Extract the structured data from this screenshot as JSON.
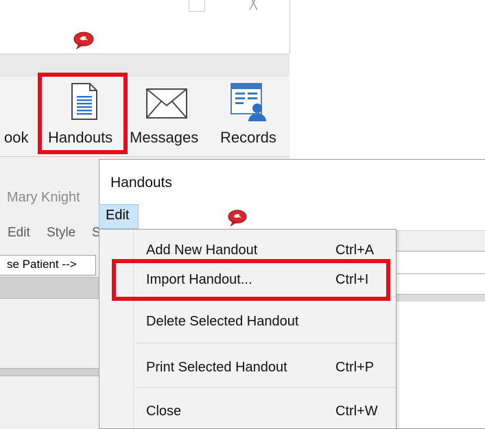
{
  "window_controls": {
    "minimize": "",
    "close": "╳"
  },
  "toolbar": {
    "items": [
      {
        "label": "ook",
        "icon": "address-book-icon"
      },
      {
        "label": "Handouts",
        "icon": "document-icon",
        "highlighted": true
      },
      {
        "label": "Messages",
        "icon": "envelope-icon"
      },
      {
        "label": "Records",
        "icon": "patient-record-icon"
      }
    ]
  },
  "background": {
    "patient_name": "Mary Knight",
    "menu_items": [
      "Edit",
      "Style",
      "S"
    ],
    "patient_select": "se Patient -->"
  },
  "handouts_window": {
    "title": "Handouts",
    "menu": {
      "edit_label": "Edit"
    }
  },
  "edit_menu": {
    "items": [
      {
        "label": "Add New Handout",
        "shortcut": "Ctrl+A"
      },
      {
        "label": "Import Handout...",
        "shortcut": "Ctrl+I",
        "highlighted": true
      },
      {
        "label": "Delete Selected Handout",
        "shortcut": ""
      },
      {
        "label": "Print Selected Handout",
        "shortcut": "Ctrl+P"
      },
      {
        "label": "Close",
        "shortcut": "Ctrl+W"
      }
    ]
  },
  "colors": {
    "highlight_red": "#e3101c",
    "menu_select_blue": "#cce4f7",
    "icon_blue": "#2e72c4",
    "notification_red": "#d8252a"
  }
}
